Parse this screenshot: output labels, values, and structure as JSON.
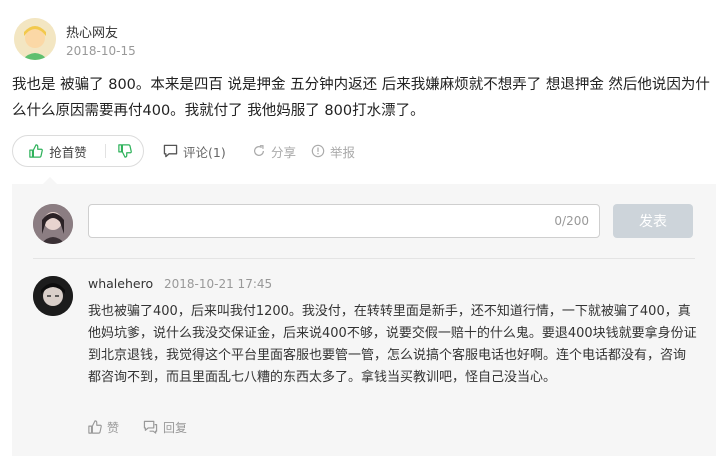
{
  "answer": {
    "username": "热心网友",
    "date": "2018-10-15",
    "text": "我也是 被骗了 800。本来是四百 说是押金 五分钟内返还 后来我嫌麻烦就不想弄了 想退押金 然后他说因为什么什么原因需要再付400。我就付了 我他妈服了 800打水漂了。"
  },
  "actions": {
    "upvote_label": "抢首赞",
    "comment_label": "评论(1)",
    "share_label": "分享",
    "report_label": "举报"
  },
  "reply_box": {
    "counter": "0/200",
    "send_label": "发表"
  },
  "comments": [
    {
      "username": "whalehero",
      "time": "2018-10-21 17:45",
      "text": "我也被骗了400，后来叫我付1200。我没付，在转转里面是新手，还不知道行情，一下就被骗了400，真他妈坑爹，说什么我没交保证金，后来说400不够，说要交假一赔十的什么鬼。要退400块钱就要拿身份证到北京退钱，我觉得这个平台里面客服也要管一管，怎么说搞个客服电话也好啊。连个电话都没有，咨询都咨询不到，而且里面乱七八糟的东西太多了。拿钱当买教训吧，怪自己没当心。",
      "like_label": "赞",
      "reply_label": "回复"
    }
  ],
  "colors": {
    "accent_green": "#2fb25b",
    "panel_bg": "#f6f6f6",
    "send_disabled": "#cdd4da"
  }
}
